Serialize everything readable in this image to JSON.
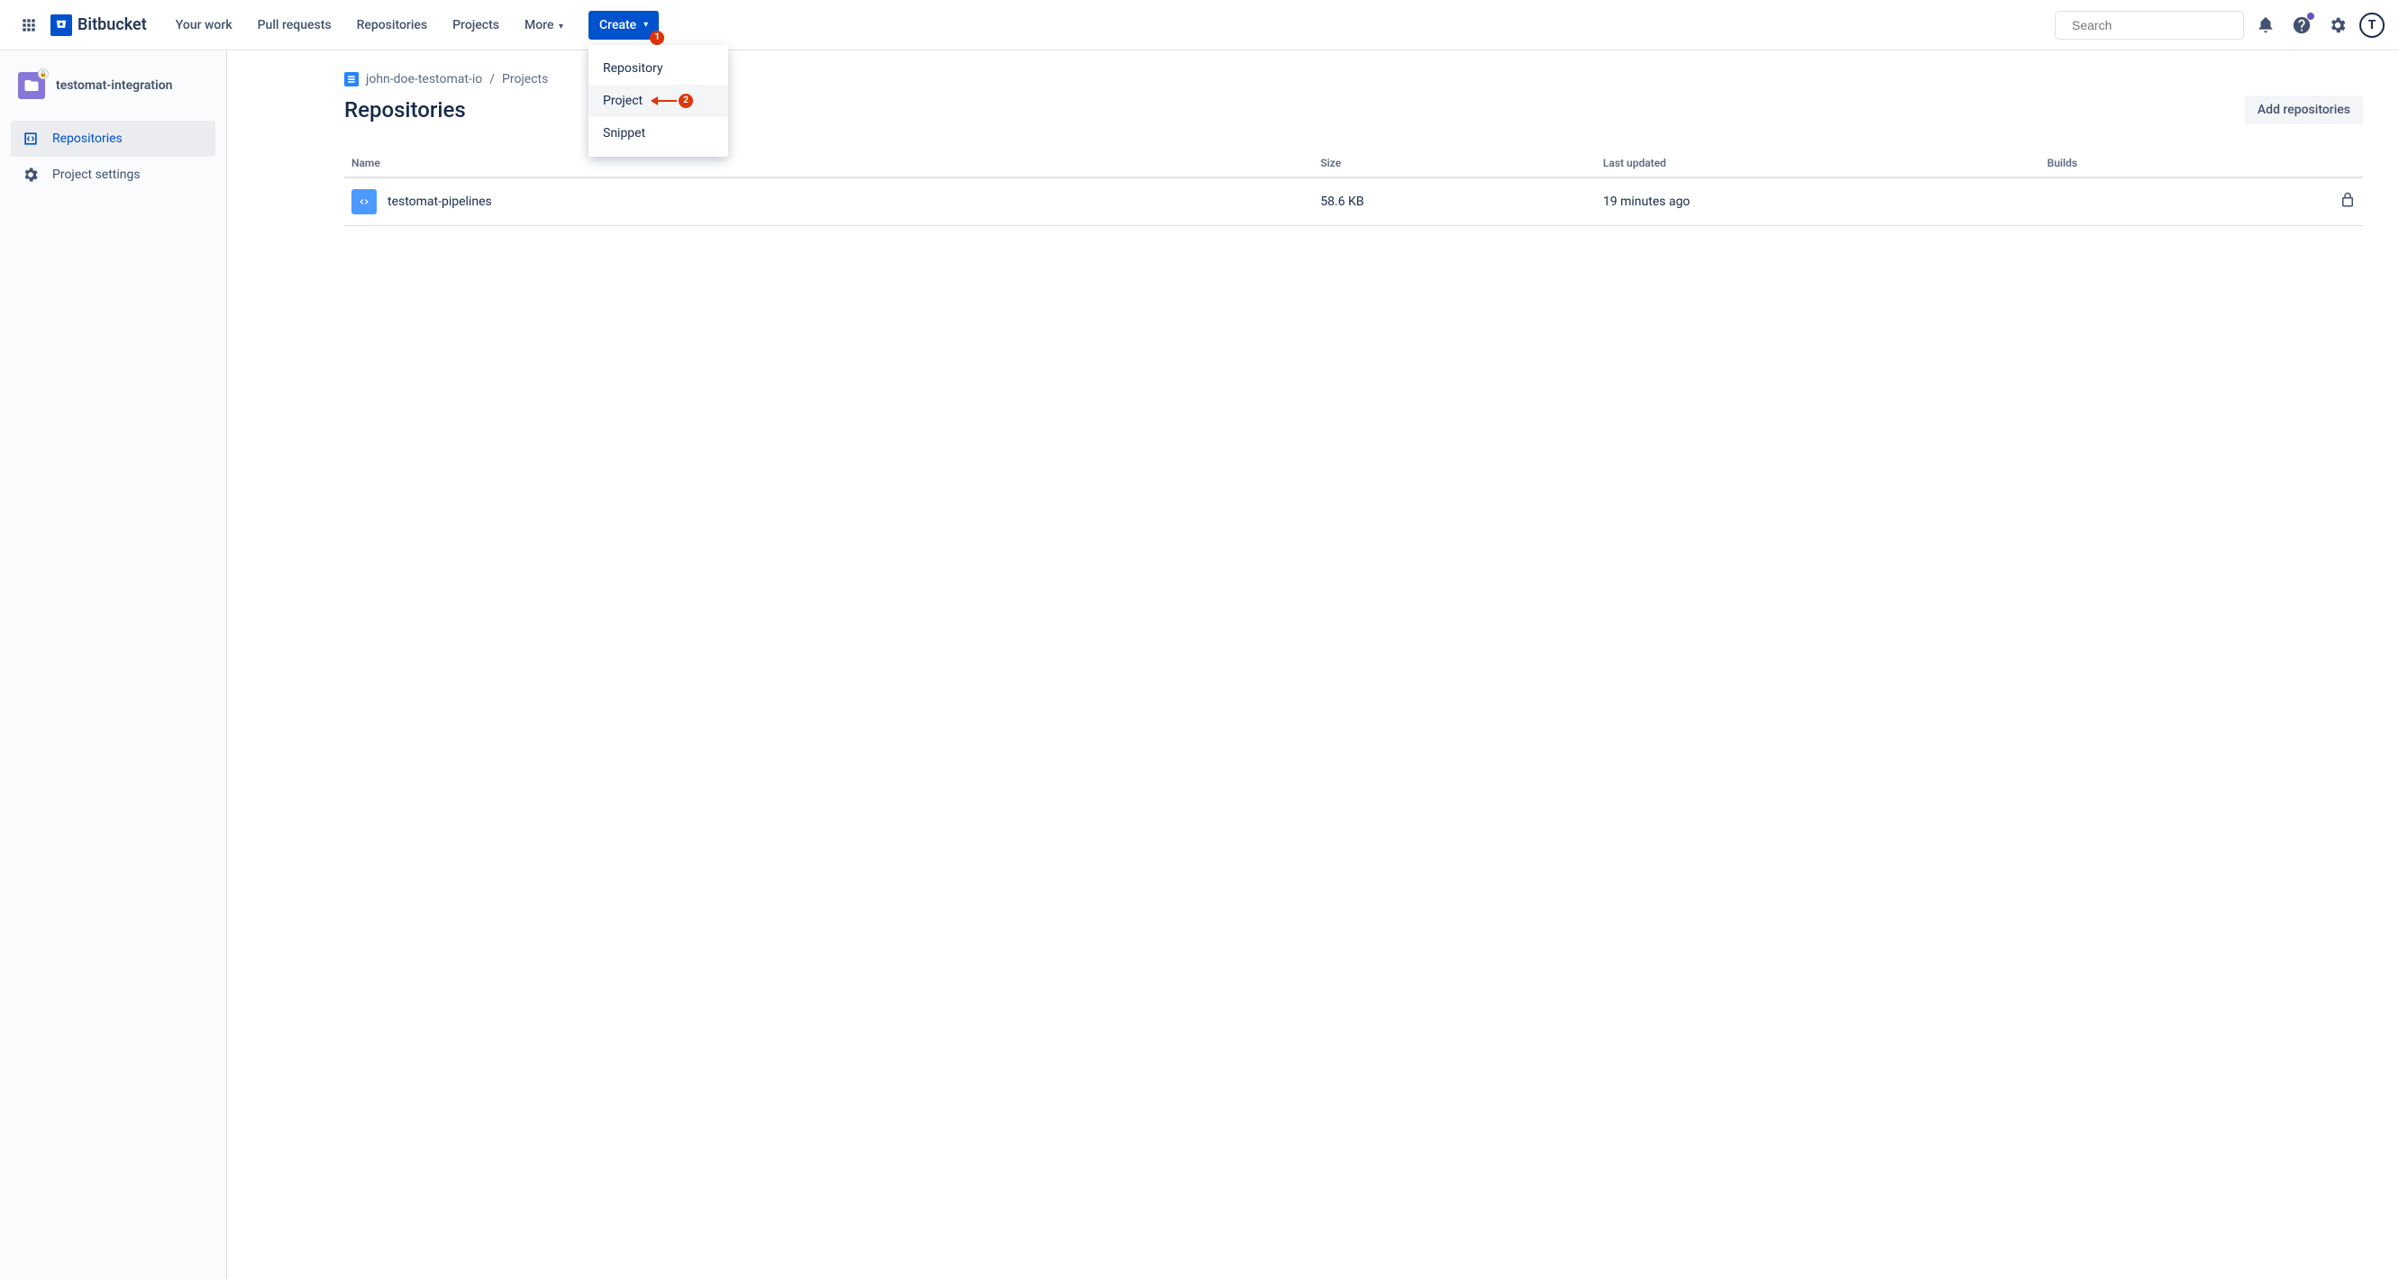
{
  "brand": "Bitbucket",
  "nav": {
    "your_work": "Your work",
    "pull_requests": "Pull requests",
    "repositories": "Repositories",
    "projects": "Projects",
    "more": "More"
  },
  "create": {
    "label": "Create",
    "menu": {
      "repository": "Repository",
      "project": "Project",
      "snippet": "Snippet"
    },
    "annotation_1": "1",
    "annotation_2": "2"
  },
  "search": {
    "placeholder": "Search"
  },
  "avatar_initial": "T",
  "sidebar": {
    "project_name": "testomat-integration",
    "repositories": "Repositories",
    "project_settings": "Project settings"
  },
  "breadcrumb": {
    "workspace": "john-doe-testomat-io",
    "projects": "Projects"
  },
  "page": {
    "title": "Repositories",
    "add_button": "Add repositories"
  },
  "table": {
    "headers": {
      "name": "Name",
      "size": "Size",
      "last_updated": "Last updated",
      "builds": "Builds"
    },
    "rows": [
      {
        "name": "testomat-pipelines",
        "size": "58.6 KB",
        "last_updated": "19 minutes ago"
      }
    ]
  }
}
